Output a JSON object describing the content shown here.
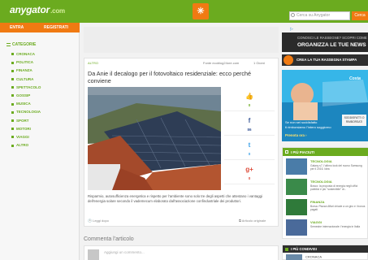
{
  "header": {
    "logo_text": "anygator",
    "logo_suffix": ".com",
    "center_icon_name": "grid-logo-icon",
    "search_placeholder": "Cerca su Anygator",
    "search_button": "Cerca"
  },
  "sidebar": {
    "login": "ENTRA",
    "register": "REGISTRATI",
    "categories_label": "CATEGORIE",
    "items": [
      "CRONACA",
      "POLITICA",
      "FINANZA",
      "CULTURA",
      "SPETTACOLO",
      "GOSSIP",
      "MUSICA",
      "TECNOLOGIA",
      "SPORT",
      "MOTORI",
      "VIAGGI",
      "ALTRO"
    ]
  },
  "article": {
    "category": "ALTRO",
    "source": "Fonte ecoblog24ore.com",
    "time": "1 Giorni",
    "title": "Da Anie il decalogo per il fotovoltaico residenziale: ecco perché conviene",
    "excerpt": "Risparmio, autosufficienza energetica e rispetto per l'ambiente sono solo tre degli aspetti che attestano i vantaggi dell'energia solare secondo il vademecum elaborato dall'associazione confindustriale dei produttori.",
    "read_more": "Leggi dopo",
    "original_link": "Articolo originale",
    "social": [
      {
        "icon": "thumbs-up-icon",
        "glyph": "👍",
        "count": "0",
        "color": "#6bab1f"
      },
      {
        "icon": "facebook-icon",
        "glyph": "f",
        "count": "86",
        "color": "#3b5998"
      },
      {
        "icon": "twitter-icon",
        "glyph": "t",
        "count": "0",
        "color": "#3aa0e8"
      },
      {
        "icon": "google-plus-icon",
        "glyph": "g+",
        "count": "0",
        "color": "#dd4b39"
      }
    ]
  },
  "comments": {
    "title": "Commenta l'articolo",
    "placeholder": "Aggiungi un commento..."
  },
  "right": {
    "adchoices": "▷",
    "banner_line1": "CONOSCI LE RASSEGNE? SCOPRI COME",
    "banner_line2": "ORGANIZZA LE TUE NEWS",
    "rassegna": "CREA LA TUA RASSEGNA STAMPA",
    "costa": {
      "logo": "Costa",
      "line1": "Se non sei soddisfatto",
      "line2": "ti rimborsiamo l'intero soggiorno",
      "cta": "Prenota ora ›",
      "badge": "SODDISFATTI O RIMBORSATI"
    },
    "news_title": "I PIÙ PIACIUTI",
    "news": [
      {
        "category": "TECNOLOGIA",
        "text": "Galaxy s7, l'ultimo look del nuovo Samsung per il 2016. Idea",
        "thumb_color": "#4a7ca8"
      },
      {
        "category": "TECNOLOGIA",
        "text": "Bosco: la proposta di energia negli uffici pubblici e più \"sostenibile\" di...",
        "thumb_color": "#3a8a4a"
      },
      {
        "category": "FINANZA",
        "text": "Borsa: Piazza Affari chiude a un giro e i bonus pagati",
        "thumb_color": "#2f7a3a"
      },
      {
        "category": "VIAGGI",
        "text": "Semestre internazionale: l'energia in Italia",
        "thumb_color": "#4a6a9a"
      }
    ],
    "conv_title": "I PIÙ CONDIVISI",
    "conv_item": "CRONACA"
  }
}
